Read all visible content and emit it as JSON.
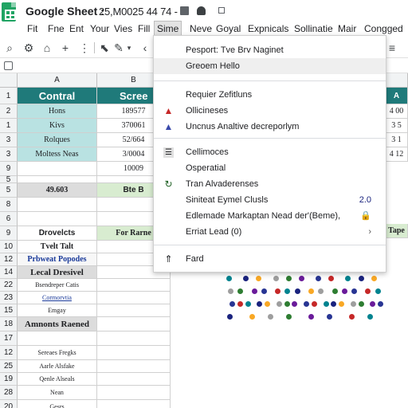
{
  "titlebar": {
    "doc_title": "Google Sheet :",
    "doc_id": "25,M0025 44 74 -"
  },
  "menubar": {
    "items": [
      "Fit",
      "Fne",
      "Ent",
      "Your",
      "Vies",
      "Fill",
      "Sime",
      "Neve",
      "Goyal",
      "Expnicals",
      "Sollinatie",
      "Mair",
      "Congged"
    ]
  },
  "grid": {
    "columns": [
      "A",
      "B"
    ],
    "rows": [
      {
        "num": "1",
        "a": "Contral",
        "b": "Scree"
      },
      {
        "num": "2",
        "a": "Hons",
        "b": "189577"
      },
      {
        "num": "1",
        "a": "Kivs",
        "b": "370061"
      },
      {
        "num": "3",
        "a": "Rolques",
        "b": "52/664"
      },
      {
        "num": "3",
        "a": "Moltess Neas",
        "b": "3/0004"
      },
      {
        "num": "9",
        "a": "",
        "b": "10009"
      },
      {
        "num": "5",
        "a": "",
        "b": ""
      },
      {
        "num": "5",
        "a": "49.603",
        "b": "Bte B"
      },
      {
        "num": "8",
        "a": "",
        "b": ""
      },
      {
        "num": "6",
        "a": "",
        "b": ""
      },
      {
        "num": "9",
        "a": "Drovelcts",
        "b": "For Rarne"
      },
      {
        "num": "10",
        "a": "Tvelt Talt",
        "b": ""
      },
      {
        "num": "12",
        "a": "Prbweat Popodes",
        "b": ""
      },
      {
        "num": "14",
        "a": "Lecal Dresivel",
        "b": ""
      },
      {
        "num": "22",
        "a": "Bsendreper Catis",
        "b": ""
      },
      {
        "num": "23",
        "a": "Cormorvtia",
        "b": ""
      },
      {
        "num": "15",
        "a": "Emgay",
        "b": ""
      },
      {
        "num": "18",
        "a": "Amnonts Raened",
        "b": ""
      },
      {
        "num": "17",
        "a": "",
        "b": ""
      },
      {
        "num": "12",
        "a": "Sereaes Fregks",
        "b": ""
      },
      {
        "num": "25",
        "a": "Aarle Alsfake",
        "b": ""
      },
      {
        "num": "19",
        "a": "Qenle Alseals",
        "b": ""
      },
      {
        "num": "28",
        "a": "Nean",
        "b": ""
      },
      {
        "num": "20",
        "a": "Gesrs",
        "b": ""
      }
    ],
    "right_values": [
      "4 00",
      "3 5",
      "3 1",
      "4 12"
    ],
    "right_header": "A",
    "right_green": "Tape"
  },
  "dropdown": {
    "items": [
      {
        "label": "Pesport: Tve Brv Naginet",
        "icon": "",
        "shortcut": ""
      },
      {
        "label": "Greoem Hello",
        "icon": "",
        "shortcut": ""
      },
      {
        "label": "Requier Zefitluns",
        "icon": "",
        "shortcut": ""
      },
      {
        "label": "Ollicineses",
        "icon": "bell-icon",
        "shortcut": ""
      },
      {
        "label": "Uncnus Analtive decreporlym",
        "icon": "flask-icon",
        "shortcut": ""
      },
      {
        "label": "Cellimoces",
        "icon": "list-icon",
        "shortcut": ""
      },
      {
        "label": "Osperatial",
        "icon": "",
        "shortcut": ""
      },
      {
        "label": "Tran Alvaderenses",
        "icon": "refresh-icon",
        "shortcut": ""
      },
      {
        "label": "Siniteat Eymel Clusls",
        "icon": "",
        "shortcut": "2.0"
      },
      {
        "label": "Edlemade Markaptan Nead der'(Beme),",
        "icon": "",
        "shortcut": "lock-icon"
      },
      {
        "label": "Erriat Lead (0)",
        "icon": "",
        "shortcut": ""
      },
      {
        "label": "Fard",
        "icon": "pin-icon",
        "shortcut": ""
      }
    ]
  },
  "colors": {
    "teal": "#1f7a7a",
    "light_blue": "#b9e2e2",
    "green_header": "#d8ecd0",
    "sheets_green": "#21a464"
  }
}
